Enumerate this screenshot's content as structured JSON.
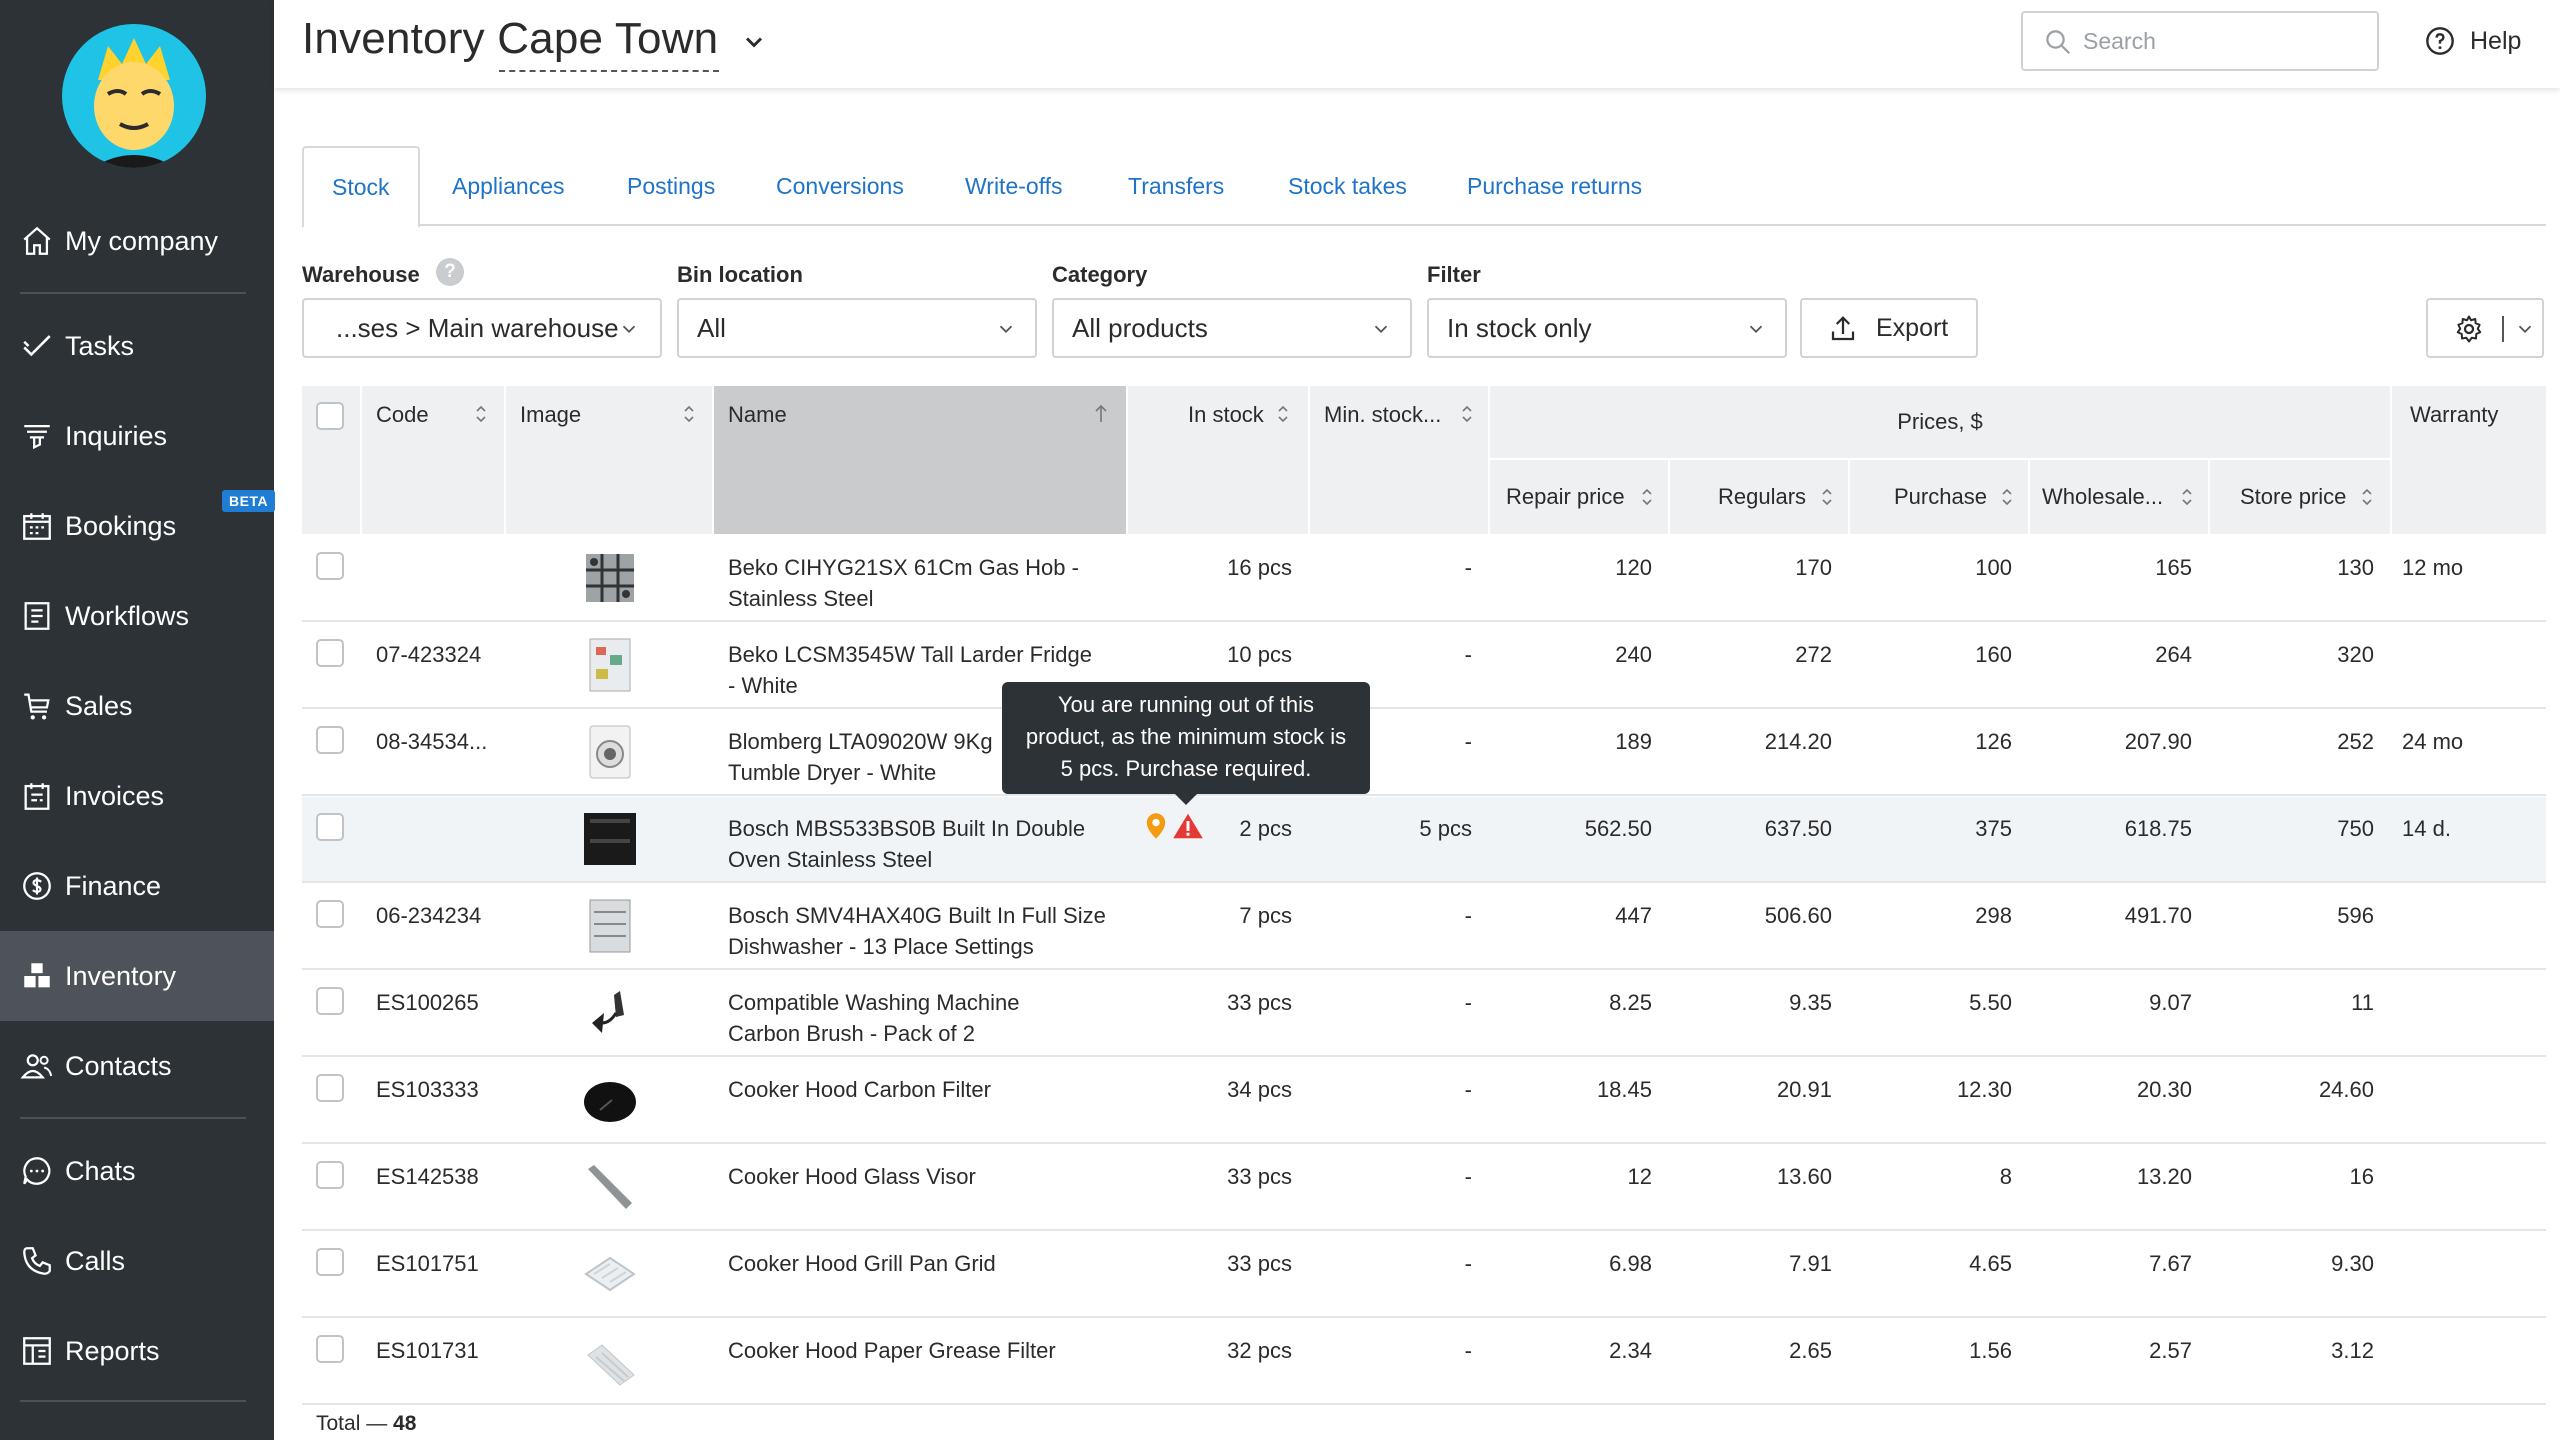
{
  "sidebar": {
    "items": [
      {
        "label": "My company",
        "icon": "home-icon"
      },
      {
        "label": "Tasks",
        "icon": "check-icon"
      },
      {
        "label": "Inquiries",
        "icon": "funnel-icon"
      },
      {
        "label": "Bookings",
        "icon": "calendar-icon",
        "badge": "BETA"
      },
      {
        "label": "Workflows",
        "icon": "clipboard-icon"
      },
      {
        "label": "Sales",
        "icon": "cart-icon"
      },
      {
        "label": "Invoices",
        "icon": "invoice-icon"
      },
      {
        "label": "Finance",
        "icon": "dollar-icon"
      },
      {
        "label": "Inventory",
        "icon": "boxes-icon",
        "active": true
      },
      {
        "label": "Contacts",
        "icon": "users-icon"
      },
      {
        "label": "Chats",
        "icon": "chat-icon"
      },
      {
        "label": "Calls",
        "icon": "phone-icon"
      },
      {
        "label": "Reports",
        "icon": "reports-icon"
      }
    ]
  },
  "header": {
    "title": "Inventory Cape Town",
    "search_placeholder": "Search",
    "help_label": "Help"
  },
  "tabs": [
    "Stock",
    "Appliances",
    "Postings",
    "Conversions",
    "Write-offs",
    "Transfers",
    "Stock takes",
    "Purchase returns"
  ],
  "active_tab": "Stock",
  "filters": {
    "warehouse_label": "Warehouse",
    "warehouse_value": "...ses > Main warehouse",
    "bin_label": "Bin location",
    "bin_value": "All",
    "category_label": "Category",
    "category_value": "All products",
    "filter_label": "Filter",
    "filter_value": "In stock only",
    "export_label": "Export"
  },
  "table": {
    "headers": {
      "code": "Code",
      "image": "Image",
      "name": "Name",
      "in_stock": "In stock",
      "min_stock": "Min. stock...",
      "prices": "Prices, $",
      "repair": "Repair price",
      "regulars": "Regulars",
      "purchase": "Purchase",
      "wholesale": "Wholesale...",
      "store": "Store price",
      "warranty": "Warranty"
    },
    "rows": [
      {
        "code": "",
        "name1": "Beko CIHYG21SX 61Cm Gas Hob -",
        "name2": "Stainless Steel",
        "stock": "16 pcs",
        "min": "-",
        "repair": "120",
        "regulars": "170",
        "purchase": "100",
        "wholesale": "165",
        "store": "130",
        "warranty": "12 mo"
      },
      {
        "code": "07-423324",
        "name1": "Beko LCSM3545W Tall Larder Fridge",
        "name2": "- White",
        "stock": "10 pcs",
        "min": "-",
        "repair": "240",
        "regulars": "272",
        "purchase": "160",
        "wholesale": "264",
        "store": "320",
        "warranty": ""
      },
      {
        "code": "08-34534...",
        "name1": "Blomberg LTA09020W 9Kg",
        "name2": "Tumble Dryer - White",
        "stock": "",
        "min": "-",
        "repair": "189",
        "regulars": "214.20",
        "purchase": "126",
        "wholesale": "207.90",
        "store": "252",
        "warranty": "24 mo"
      },
      {
        "code": "",
        "name1": "Bosch MBS533BS0B Built In Double",
        "name2": "Oven Stainless Steel",
        "stock": "2 pcs",
        "min": "5 pcs",
        "repair": "562.50",
        "regulars": "637.50",
        "purchase": "375",
        "wholesale": "618.75",
        "store": "750",
        "warranty": "14 d."
      },
      {
        "code": "06-234234",
        "name1": "Bosch SMV4HAX40G Built In Full Size",
        "name2": "Dishwasher - 13 Place Settings",
        "stock": "7 pcs",
        "min": "-",
        "repair": "447",
        "regulars": "506.60",
        "purchase": "298",
        "wholesale": "491.70",
        "store": "596",
        "warranty": ""
      },
      {
        "code": "ES100265",
        "name1": "Compatible Washing Machine",
        "name2": "Carbon Brush - Pack of 2",
        "stock": "33 pcs",
        "min": "-",
        "repair": "8.25",
        "regulars": "9.35",
        "purchase": "5.50",
        "wholesale": "9.07",
        "store": "11",
        "warranty": ""
      },
      {
        "code": "ES103333",
        "name1": "Cooker Hood Carbon Filter",
        "name2": "",
        "stock": "34 pcs",
        "min": "-",
        "repair": "18.45",
        "regulars": "20.91",
        "purchase": "12.30",
        "wholesale": "20.30",
        "store": "24.60",
        "warranty": ""
      },
      {
        "code": "ES142538",
        "name1": "Cooker Hood Glass Visor",
        "name2": "",
        "stock": "33 pcs",
        "min": "-",
        "repair": "12",
        "regulars": "13.60",
        "purchase": "8",
        "wholesale": "13.20",
        "store": "16",
        "warranty": ""
      },
      {
        "code": "ES101751",
        "name1": "Cooker Hood Grill Pan Grid",
        "name2": "",
        "stock": "33 pcs",
        "min": "-",
        "repair": "6.98",
        "regulars": "7.91",
        "purchase": "4.65",
        "wholesale": "7.67",
        "store": "9.30",
        "warranty": ""
      },
      {
        "code": "ES101731",
        "name1": "Cooker Hood Paper Grease Filter",
        "name2": "",
        "stock": "32 pcs",
        "min": "-",
        "repair": "2.34",
        "regulars": "2.65",
        "purchase": "1.56",
        "wholesale": "2.57",
        "store": "3.12",
        "warranty": ""
      }
    ],
    "total_label": "Total —",
    "total_value": "48"
  },
  "tooltip": {
    "line1": "You are running out of this",
    "line2": "product, as the minimum stock is",
    "line3": "5 pcs. Purchase required."
  },
  "colors": {
    "sidebar": "#2d3236",
    "link": "#1f73c8",
    "warning": "#e53935",
    "location": "#f39c12"
  }
}
